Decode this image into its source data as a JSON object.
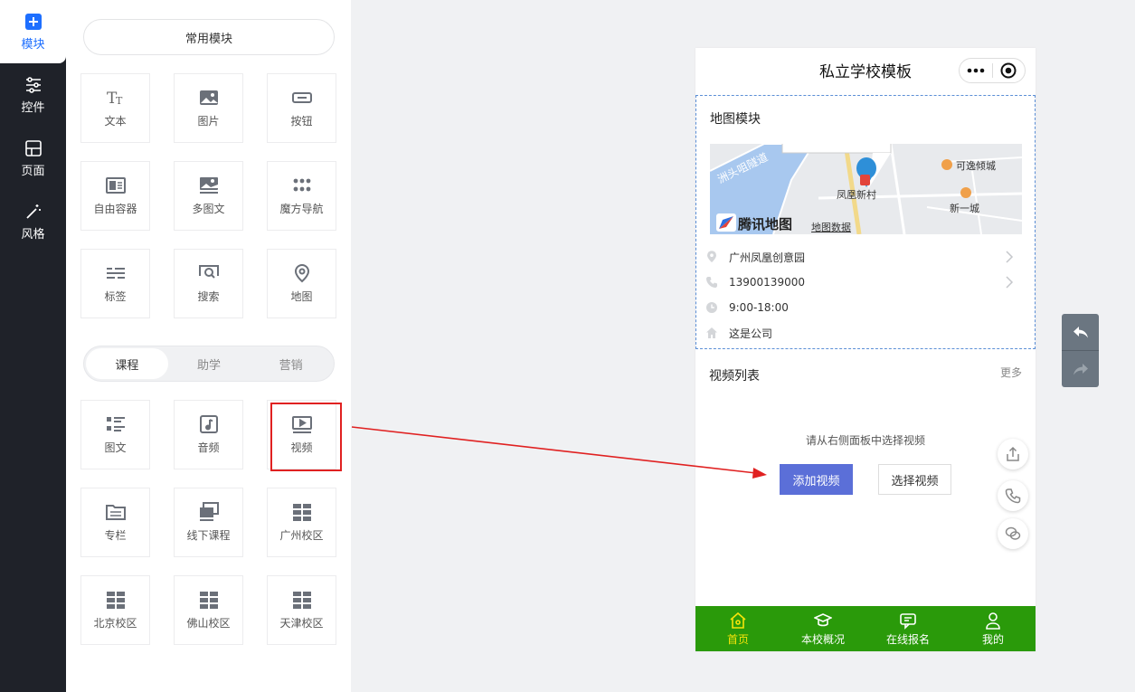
{
  "nav": {
    "items": [
      {
        "label": "模块",
        "icon": "plus-square-icon",
        "active": true
      },
      {
        "label": "控件",
        "icon": "sliders-icon"
      },
      {
        "label": "页面",
        "icon": "page-layout-icon"
      },
      {
        "label": "风格",
        "icon": "magic-wand-icon"
      }
    ]
  },
  "panel": {
    "common_pill": "常用模块",
    "common_tiles": [
      {
        "label": "文本",
        "icon": "text-icon"
      },
      {
        "label": "图片",
        "icon": "image-icon"
      },
      {
        "label": "按钮",
        "icon": "button-icon"
      },
      {
        "label": "自由容器",
        "icon": "container-icon"
      },
      {
        "label": "多图文",
        "icon": "multi-image-icon"
      },
      {
        "label": "魔方导航",
        "icon": "grid-dots-icon"
      },
      {
        "label": "标签",
        "icon": "tag-lines-icon"
      },
      {
        "label": "搜索",
        "icon": "search-icon"
      },
      {
        "label": "地图",
        "icon": "map-pin-icon"
      }
    ],
    "tabs": [
      {
        "label": "课程",
        "active": true
      },
      {
        "label": "助学"
      },
      {
        "label": "营销"
      }
    ],
    "course_tiles": [
      {
        "label": "图文",
        "icon": "list-image-icon"
      },
      {
        "label": "音频",
        "icon": "audio-icon"
      },
      {
        "label": "视频",
        "icon": "video-icon"
      },
      {
        "label": "专栏",
        "icon": "folder-icon"
      },
      {
        "label": "线下课程",
        "icon": "offline-course-icon"
      },
      {
        "label": "广州校区",
        "icon": "campus-grid-icon"
      },
      {
        "label": "北京校区",
        "icon": "campus-grid-icon"
      },
      {
        "label": "佛山校区",
        "icon": "campus-grid-icon"
      },
      {
        "label": "天津校区",
        "icon": "campus-grid-icon"
      }
    ]
  },
  "phone": {
    "title": "私立学校模板",
    "map_module": {
      "title": "地图模块",
      "map_labels": {
        "road": "洲头咀隧道",
        "place1": "凤凰新村",
        "place2": "可逸倾城",
        "place3": "新一城",
        "brand": "腾讯地图",
        "data": "地图数据"
      },
      "rows": [
        {
          "icon": "location-icon",
          "text": "广州凤凰创意园",
          "chevron": true
        },
        {
          "icon": "phone-icon",
          "text": "13900139000",
          "chevron": true
        },
        {
          "icon": "clock-icon",
          "text": "9:00-18:00",
          "chevron": false
        },
        {
          "icon": "home-icon",
          "text": "这是公司",
          "chevron": false
        }
      ]
    },
    "video_module": {
      "title": "视频列表",
      "more": "更多",
      "hint": "请从右侧面板中选择视频",
      "add_label": "添加视频",
      "choose_label": "选择视频"
    },
    "tabbar": [
      {
        "label": "首页",
        "icon": "home-icon",
        "active": true
      },
      {
        "label": "本校概况",
        "icon": "graduation-cap-icon"
      },
      {
        "label": "在线报名",
        "icon": "message-icon"
      },
      {
        "label": "我的",
        "icon": "user-icon"
      }
    ]
  },
  "colors": {
    "accent": "#1e6fff",
    "tabbar": "#2a9a0a",
    "tabbar_active": "#f5e40a",
    "add_button": "#5b6fd8",
    "highlight": "#e02121"
  }
}
